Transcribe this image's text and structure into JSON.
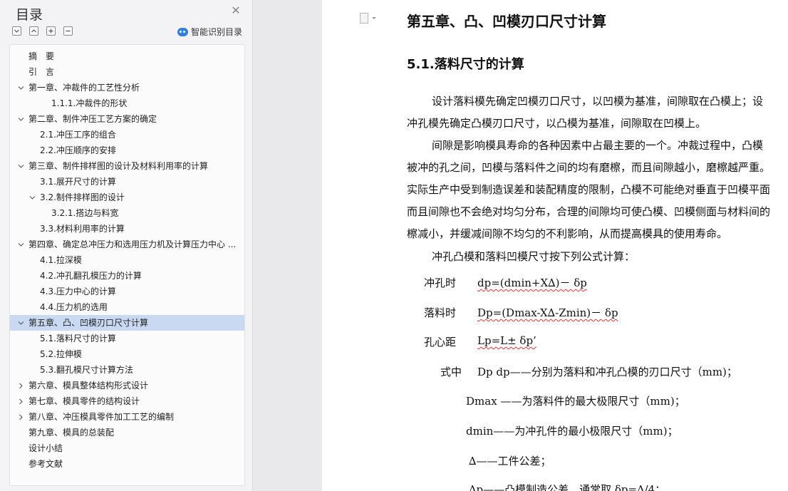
{
  "sidebar": {
    "title": "目录",
    "smart_label": "智能识别目录",
    "toc": [
      {
        "text": "摘　要",
        "level": 0,
        "chev": "none"
      },
      {
        "text": "引　言",
        "level": 0,
        "chev": "none"
      },
      {
        "text": "第一章、冲裁件的工艺性分析",
        "level": 0,
        "chev": "down"
      },
      {
        "text": "1.1.1.冲裁件的形状",
        "level": 2,
        "chev": "none"
      },
      {
        "text": "第二章、制件冲压工艺方案的确定",
        "level": 0,
        "chev": "down"
      },
      {
        "text": "2.1.冲压工序的组合",
        "level": 1,
        "chev": "none"
      },
      {
        "text": "2.2.冲压顺序的安排",
        "level": 1,
        "chev": "none"
      },
      {
        "text": "第三章、制件排样图的设计及材料利用率的计算",
        "level": 0,
        "chev": "down"
      },
      {
        "text": "3.1.展开尺寸的计算",
        "level": 1,
        "chev": "none"
      },
      {
        "text": "3.2.制件排样图的设计",
        "level": 1,
        "chev": "down"
      },
      {
        "text": "3.2.1.搭边与料宽",
        "level": 2,
        "chev": "none"
      },
      {
        "text": "3.3.材料利用率的计算",
        "level": 1,
        "chev": "none"
      },
      {
        "text": "第四章、确定总冲压力和选用压力机及计算压力中心 ...",
        "level": 0,
        "chev": "down"
      },
      {
        "text": "4.1.拉深模",
        "level": 1,
        "chev": "none"
      },
      {
        "text": "4.2.冲孔翻孔模压力的计算",
        "level": 1,
        "chev": "none"
      },
      {
        "text": "4.3.压力中心的计算",
        "level": 1,
        "chev": "none"
      },
      {
        "text": "4.4.压力机的选用",
        "level": 1,
        "chev": "none"
      },
      {
        "text": "第五章、凸、凹模刃口尺寸计算",
        "level": 0,
        "chev": "down",
        "active": true
      },
      {
        "text": "5.1.落料尺寸的计算",
        "level": 1,
        "chev": "none"
      },
      {
        "text": "5.2.拉伸模",
        "level": 1,
        "chev": "none"
      },
      {
        "text": "5.3.翻孔模尺寸计算方法",
        "level": 1,
        "chev": "none"
      },
      {
        "text": "第六章、模具整体结构形式设计",
        "level": 0,
        "chev": "right"
      },
      {
        "text": "第七章、模具零件的结构设计",
        "level": 0,
        "chev": "right"
      },
      {
        "text": "第八章、冲压模具零件加工工艺的编制",
        "level": 0,
        "chev": "right"
      },
      {
        "text": "第九章、模具的总装配",
        "level": 0,
        "chev": "none"
      },
      {
        "text": "设计小结",
        "level": 0,
        "chev": "none"
      },
      {
        "text": "参考文献",
        "level": 0,
        "chev": "none"
      }
    ]
  },
  "document": {
    "heading1": "第五章、凸、凹模刃口尺寸计算",
    "heading2": "5.1.落料尺寸的计算",
    "para1_l1": "设计落料模先确定凹模刃口尺寸，以凹模为基准，间隙取在凸模上；设",
    "para1_l2": "冲孔模先确定凸模刃口尺寸，以凸模为基准，间隙取在凹模上。",
    "para2_l1": "间隙是影响模具寿命的各种因素中占最主要的一个。冲裁过程中，凸模",
    "para2_l2": "被冲的孔之间，凹模与落料件之间的均有磨檫，而且间隙越小，磨檫越严重。",
    "para2_l3": "实际生产中受到制造误差和装配精度的限制，凸模不可能绝对垂直于凹模平面",
    "para2_l4": "而且间隙也不会绝对均匀分布，合理的间隙均可使凸模、凹模侧面与材料间的",
    "para2_l5": "檫减小，并缓减间隙不均匀的不利影响，从而提高模具的使用寿命。",
    "para3": "冲孔凸模和落料凹模尺寸按下列公式计算：",
    "f1_label": "冲孔时",
    "f1_expr": "dp=(dmin+X∆)－ δp",
    "f2_label": "落料时",
    "f2_expr": "Dp=(Dmax-X∆-Zmin)－ δp",
    "f3_label": "孔心距",
    "f3_expr": "Lp=L± δp’",
    "where_label": "式中",
    "where_text": "Dp dp——分别为落料和冲孔凸模的刃口尺寸（mm)；",
    "def1": "Dmax ——为落料件的最大极限尺寸（mm)；",
    "def2": "dmin——为冲孔件的最小极限尺寸（mm)；",
    "def3": "∆——工件公差；",
    "def4": "∆p——凸模制造公差，通常取 δp=∆/4；"
  }
}
